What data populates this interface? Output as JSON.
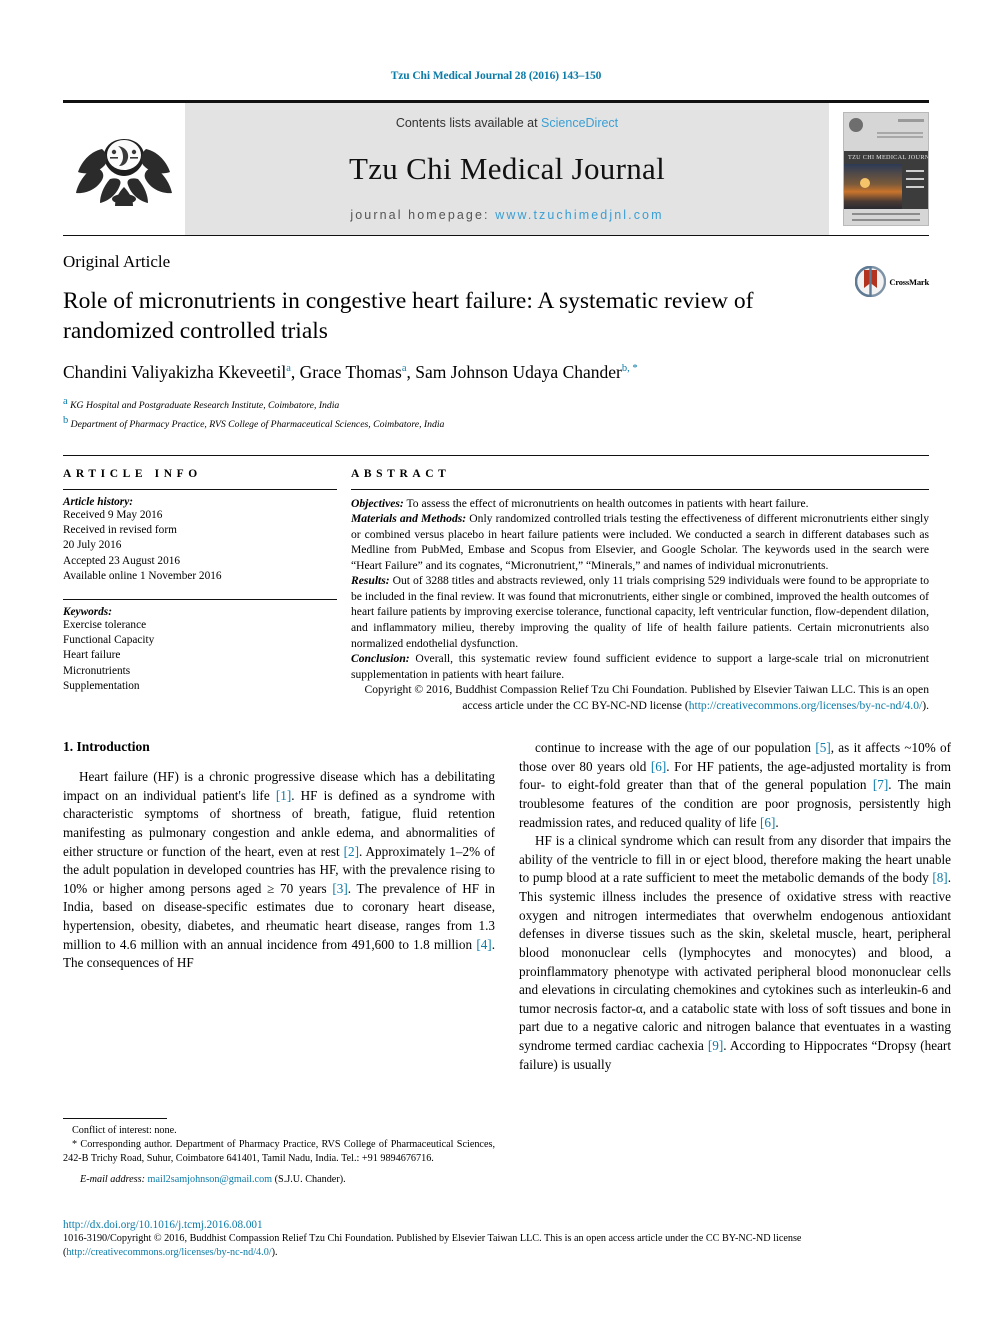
{
  "running_head": "Tzu Chi Medical Journal 28 (2016) 143–150",
  "masthead": {
    "contents_prefix": "Contents lists available at ",
    "contents_link": "ScienceDirect",
    "journal_name": "Tzu Chi Medical Journal",
    "homepage_prefix": "journal homepage: ",
    "homepage_link": "www.tzuchimedjnl.com",
    "cover_title": "TZU CHI MEDICAL JOURNAL",
    "logo_icon": "tzu-chi-lotus-emblem-icon",
    "cover_icon": "journal-cover-thumbnail-icon"
  },
  "article": {
    "type": "Original Article",
    "title": "Role of micronutrients in congestive heart failure: A systematic review of randomized controlled trials",
    "authors_segments": [
      {
        "name": "Chandini Valiyakizha Kkeveetil",
        "sup": "a"
      },
      {
        "name": "Grace Thomas",
        "sup": "a"
      },
      {
        "name": "Sam Johnson Udaya Chander",
        "sup": "b, *"
      }
    ],
    "affiliations": [
      {
        "sup": "a",
        "text": "KG Hospital and Postgraduate Research Institute, Coimbatore, India"
      },
      {
        "sup": "b",
        "text": "Department of Pharmacy Practice, RVS College of Pharmaceutical Sciences, Coimbatore, India"
      }
    ],
    "crossmark_label": "CrossMark",
    "crossmark_icon": "crossmark-logo-icon"
  },
  "info": {
    "heading": "ARTICLE INFO",
    "history_label": "Article history:",
    "history": [
      "Received 9 May 2016",
      "Received in revised form",
      "20 July 2016",
      "Accepted 23 August 2016",
      "Available online 1 November 2016"
    ],
    "keywords_label": "Keywords:",
    "keywords": [
      "Exercise tolerance",
      "Functional Capacity",
      "Heart failure",
      "Micronutrients",
      "Supplementation"
    ]
  },
  "abstract": {
    "heading": "ABSTRACT",
    "objectives_label": "Objectives:",
    "objectives_text": " To assess the effect of micronutrients on health outcomes in patients with heart failure.",
    "methods_label": "Materials and Methods:",
    "methods_text": " Only randomized controlled trials testing the effectiveness of different micronutrients either singly or combined versus placebo in heart failure patients were included. We conducted a search in different databases such as Medline from PubMed, Embase and Scopus from Elsevier, and Google Scholar. The keywords used in the search were “Heart Failure” and its cognates, “Micronutrient,” “Minerals,” and names of individual micronutrients.",
    "results_label": "Results:",
    "results_text": " Out of 3288 titles and abstracts reviewed, only 11 trials comprising 529 individuals were found to be appropriate to be included in the final review. It was found that micronutrients, either single or combined, improved the health outcomes of heart failure patients by improving exercise tolerance, functional capacity, left ventricular function, flow-dependent dilation, and inflammatory milieu, thereby improving the quality of life of health failure patients. Certain micronutrients also normalized endothelial dysfunction.",
    "conclusion_label": "Conclusion:",
    "conclusion_text": " Overall, this systematic review found sufficient evidence to support a large-scale trial on micronutrient supplementation in patients with heart failure.",
    "copyright_text": "Copyright © 2016, Buddhist Compassion Relief Tzu Chi Foundation. Published by Elsevier Taiwan LLC. This is an open access article under the CC BY-NC-ND license (",
    "copyright_link": "http://creativecommons.org/licenses/by-nc-nd/4.0/",
    "copyright_suffix": ")."
  },
  "body": {
    "section_heading": "1. Introduction",
    "left_paragraph_1": "Heart failure (HF) is a chronic progressive disease which has a debilitating impact on an individual patient's life [1]. HF is defined as a syndrome with characteristic symptoms of shortness of breath, fatigue, fluid retention manifesting as pulmonary congestion and ankle edema, and abnormalities of either structure or function of the heart, even at rest [2]. Approximately 1–2% of the adult population in developed countries has HF, with the prevalence rising to 10% or higher among persons aged ≥ 70 years [3]. The prevalence of HF in India, based on disease-specific estimates due to coronary heart disease, hypertension, obesity, diabetes, and rheumatic heart disease, ranges from 1.3 million to 4.6 million with an annual incidence from 491,600 to 1.8 million [4]. The consequences of HF",
    "right_paragraph_1": "continue to increase with the age of our population [5], as it affects ~10% of those over 80 years old [6]. For HF patients, the age-adjusted mortality is from four- to eight-fold greater than that of the general population [7]. The main troublesome features of the condition are poor prognosis, persistently high readmission rates, and reduced quality of life [6].",
    "right_paragraph_2": "HF is a clinical syndrome which can result from any disorder that impairs the ability of the ventricle to fill in or eject blood, therefore making the heart unable to pump blood at a rate sufficient to meet the metabolic demands of the body [8]. This systemic illness includes the presence of oxidative stress with reactive oxygen and nitrogen intermediates that overwhelm endogenous antioxidant defenses in diverse tissues such as the skin, skeletal muscle, heart, peripheral blood mononuclear cells (lymphocytes and monocytes) and blood, a proinflammatory phenotype with activated peripheral blood mononuclear cells and elevations in circulating chemokines and cytokines such as interleukin-6 and tumor necrosis factor-α, and a catabolic state with loss of soft tissues and bone in part due to a negative caloric and nitrogen balance that eventuates in a wasting syndrome termed cardiac cachexia [9]. According to Hippocrates “Dropsy (heart failure) is usually"
  },
  "footnotes": {
    "conflict": "Conflict of interest: none.",
    "corresponding": "* Corresponding author. Department of Pharmacy Practice, RVS College of Pharmaceutical Sciences, 242-B Trichy Road, Suhur, Coimbatore 641401, Tamil Nadu, India. Tel.: +91 9894676716.",
    "email_label": "E-mail address:",
    "email_link": "mail2samjohnson@gmail.com",
    "email_suffix": " (S.J.U. Chander)."
  },
  "footer": {
    "doi": "http://dx.doi.org/10.1016/j.tcmj.2016.08.001",
    "copyright": "1016-3190/Copyright © 2016, Buddhist Compassion Relief Tzu Chi Foundation. Published by Elsevier Taiwan LLC. This is an open access article under the CC BY-NC-ND license",
    "copyright_open": "(",
    "copyright_link": "http://creativecommons.org/licenses/by-nc-nd/4.0/",
    "copyright_close": ")."
  },
  "colors": {
    "link_blue": "#0b7ba8",
    "sciencedirect_blue": "#3a9fd4",
    "band_gray": "#e3e3e3"
  }
}
